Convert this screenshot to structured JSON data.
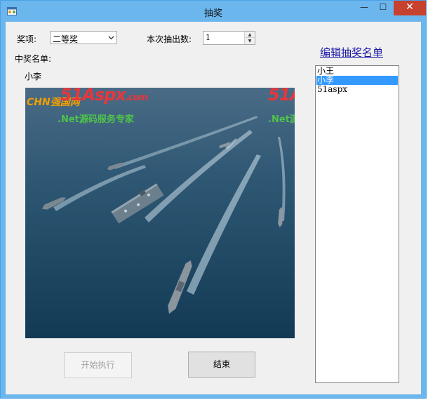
{
  "window": {
    "title": "抽奖",
    "controls": {
      "minimize": "—",
      "maximize": "☐",
      "close": "✕"
    },
    "frame_color": "#6cb6ee",
    "close_color": "#c7412f"
  },
  "form": {
    "prize_label": "奖项:",
    "prize_selected": "二等奖",
    "draw_count_label": "本次抽出数:",
    "draw_count_value": "1",
    "winners_label": "中奖名单:",
    "winner_name": "小李",
    "edit_list_link": "编辑抽奖名单"
  },
  "participants": {
    "items": [
      {
        "label": "小王",
        "selected": false
      },
      {
        "label": "小李",
        "selected": true
      },
      {
        "label": "51aspx",
        "selected": false
      }
    ],
    "selection_color": "#3399ff"
  },
  "photo": {
    "watermark_brand": "51Aspx",
    "watermark_domain": ".com",
    "watermark_slogan": ".Net源码服务专家",
    "watermark_chn": "CHN强国网"
  },
  "buttons": {
    "start": "开始执行",
    "end": "结束"
  },
  "icons": [
    "app-icon",
    "minimize-icon",
    "maximize-icon",
    "close-icon",
    "chevron-down-icon",
    "spin-up-icon",
    "spin-down-icon"
  ]
}
